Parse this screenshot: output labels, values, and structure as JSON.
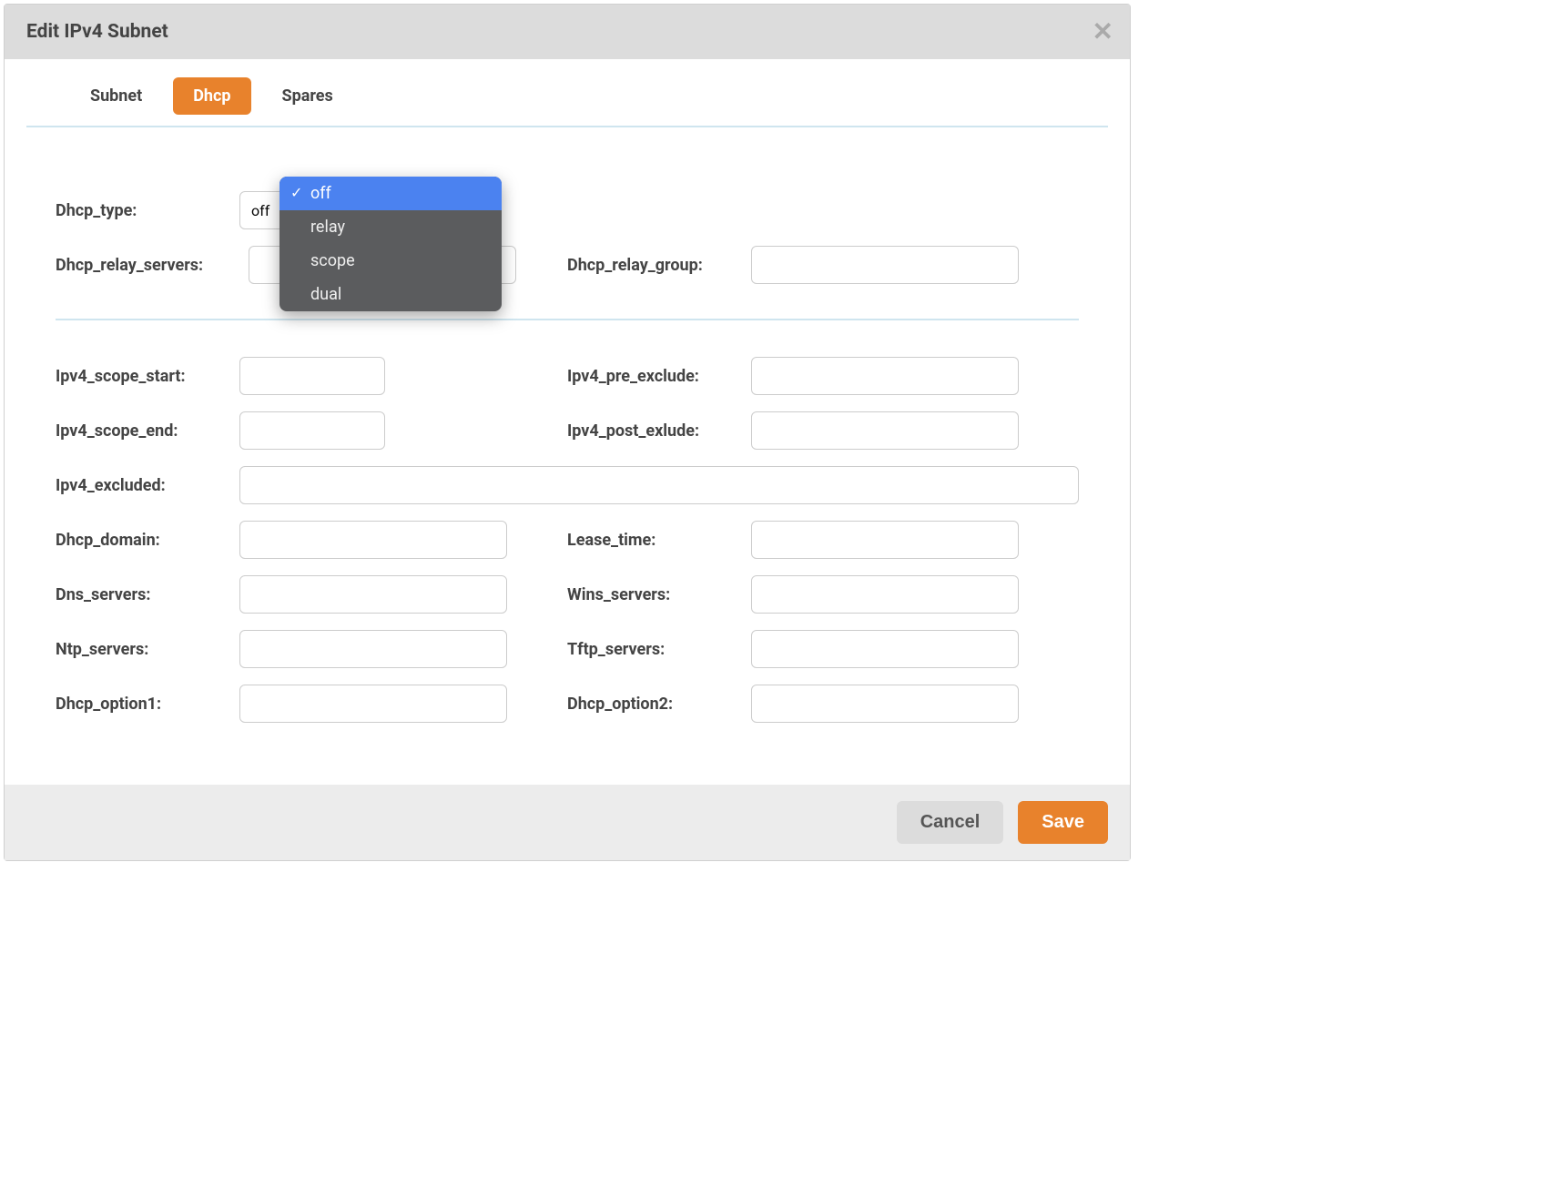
{
  "modal": {
    "title": "Edit IPv4 Subnet"
  },
  "tabs": {
    "subnet": "Subnet",
    "dhcp": "Dhcp",
    "spares": "Spares"
  },
  "labels": {
    "dhcp_type": "Dhcp_type:",
    "dhcp_relay_servers": "Dhcp_relay_servers:",
    "dhcp_relay_group": "Dhcp_relay_group:",
    "ipv4_scope_start": "Ipv4_scope_start:",
    "ipv4_pre_exclude": "Ipv4_pre_exclude:",
    "ipv4_scope_end": "Ipv4_scope_end:",
    "ipv4_post_exlude": "Ipv4_post_exlude:",
    "ipv4_excluded": "Ipv4_excluded:",
    "dhcp_domain": "Dhcp_domain:",
    "lease_time": "Lease_time:",
    "dns_servers": "Dns_servers:",
    "wins_servers": "Wins_servers:",
    "ntp_servers": "Ntp_servers:",
    "tftp_servers": "Tftp_servers:",
    "dhcp_option1": "Dhcp_option1:",
    "dhcp_option2": "Dhcp_option2:"
  },
  "dhcp_type": {
    "selected": "off",
    "options": [
      "off",
      "relay",
      "scope",
      "dual"
    ]
  },
  "values": {
    "dhcp_relay_servers": "",
    "dhcp_relay_group": "",
    "ipv4_scope_start": "",
    "ipv4_pre_exclude": "",
    "ipv4_scope_end": "",
    "ipv4_post_exlude": "",
    "ipv4_excluded": "",
    "dhcp_domain": "",
    "lease_time": "",
    "dns_servers": "",
    "wins_servers": "",
    "ntp_servers": "",
    "tftp_servers": "",
    "dhcp_option1": "",
    "dhcp_option2": ""
  },
  "buttons": {
    "cancel": "Cancel",
    "save": "Save"
  }
}
